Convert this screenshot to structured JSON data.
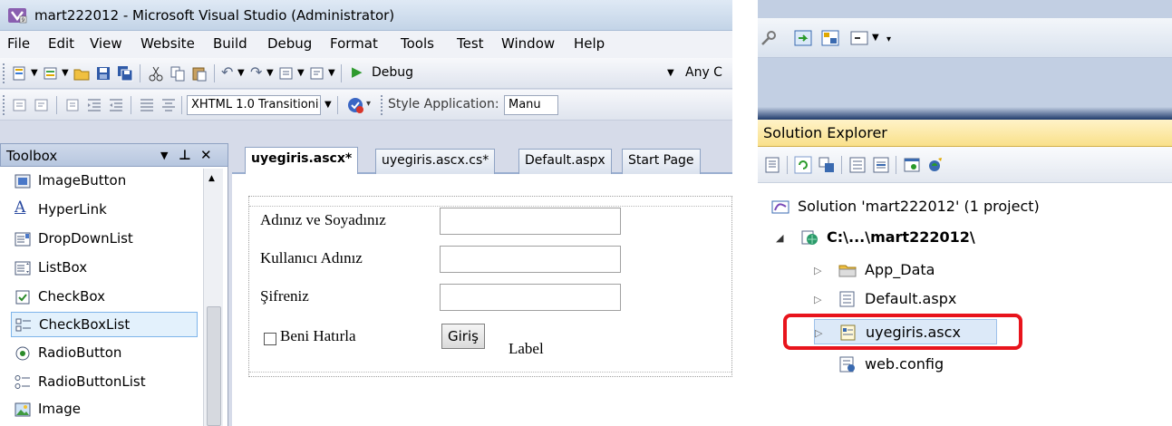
{
  "vs": {
    "title": "mart222012 - Microsoft Visual Studio (Administrator)",
    "menu": [
      "File",
      "Edit",
      "View",
      "Website",
      "Build",
      "Debug",
      "Format",
      "Tools",
      "Test",
      "Window",
      "Help"
    ],
    "toolbar1": {
      "config_value": "Debug",
      "platform_value": "Any C"
    },
    "toolbar2": {
      "doctype_value": "XHTML 1.0 Transitioni",
      "style_app_label": "Style Application:",
      "style_app_value": "Manu"
    }
  },
  "toolbox": {
    "title": "Toolbox",
    "pin": "−̄ a",
    "items": [
      {
        "label": "ImageButton",
        "icon": "image-button-icon"
      },
      {
        "label": "HyperLink",
        "icon": "hyperlink-icon"
      },
      {
        "label": "DropDownList",
        "icon": "dropdownlist-icon"
      },
      {
        "label": "ListBox",
        "icon": "listbox-icon"
      },
      {
        "label": "CheckBox",
        "icon": "checkbox-icon"
      },
      {
        "label": "CheckBoxList",
        "icon": "checkboxlist-icon"
      },
      {
        "label": "RadioButton",
        "icon": "radiobutton-icon"
      },
      {
        "label": "RadioButtonList",
        "icon": "radiobuttonlist-icon"
      },
      {
        "label": "Image",
        "icon": "image-icon"
      }
    ],
    "selected_index": 5
  },
  "editor": {
    "tabs": [
      {
        "label": "uyegiris.ascx*",
        "active": true
      },
      {
        "label": "uyegiris.ascx.cs*",
        "active": false
      },
      {
        "label": "Default.aspx",
        "active": false
      },
      {
        "label": "Start Page",
        "active": false
      }
    ],
    "form": {
      "name_label": "Adınız ve Soyadınız",
      "user_label": "Kullanıcı Adınız",
      "pass_label": "Şifreniz",
      "remember_label": "Beni Hatırla",
      "login_button": "Giriş",
      "status_label": "Label",
      "name_value": "",
      "user_value": "",
      "pass_value": ""
    }
  },
  "solution_explorer": {
    "title": "Solution Explorer",
    "solution_label": "Solution 'mart222012' (1 project)",
    "project_label": "C:\\...\\mart222012\\",
    "items": [
      {
        "label": "App_Data",
        "icon": "folder-icon",
        "expandable": true
      },
      {
        "label": "Default.aspx",
        "icon": "aspx-file-icon",
        "expandable": true
      },
      {
        "label": "uyegiris.ascx",
        "icon": "ascx-file-icon",
        "expandable": true,
        "selected": true
      },
      {
        "label": "web.config",
        "icon": "config-file-icon",
        "expandable": false
      }
    ],
    "highlight_color": "#e8141c"
  }
}
